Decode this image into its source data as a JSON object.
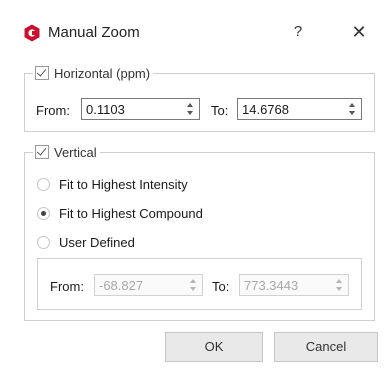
{
  "window": {
    "title": "Manual Zoom",
    "help_label": "?",
    "close_label": "✕",
    "icon": "app-logo-icon"
  },
  "horizontal": {
    "enabled": true,
    "label": "Horizontal (ppm)",
    "from_label": "From:",
    "from_value": "0.1103",
    "to_label": "To:",
    "to_value": "14.6768"
  },
  "vertical": {
    "enabled": true,
    "label": "Vertical",
    "options": [
      {
        "label": "Fit to Highest Intensity",
        "selected": false
      },
      {
        "label": "Fit to Highest Compound",
        "selected": true
      },
      {
        "label": "User Defined",
        "selected": false
      }
    ],
    "from_label": "From:",
    "from_value": "-68.827",
    "to_label": "To:",
    "to_value": "773.3443",
    "fields_enabled": false
  },
  "buttons": {
    "ok": "OK",
    "cancel": "Cancel"
  },
  "colors": {
    "logo": "#c8102e",
    "border": "#cfcfcf",
    "button_bg": "#e9e9e9"
  }
}
